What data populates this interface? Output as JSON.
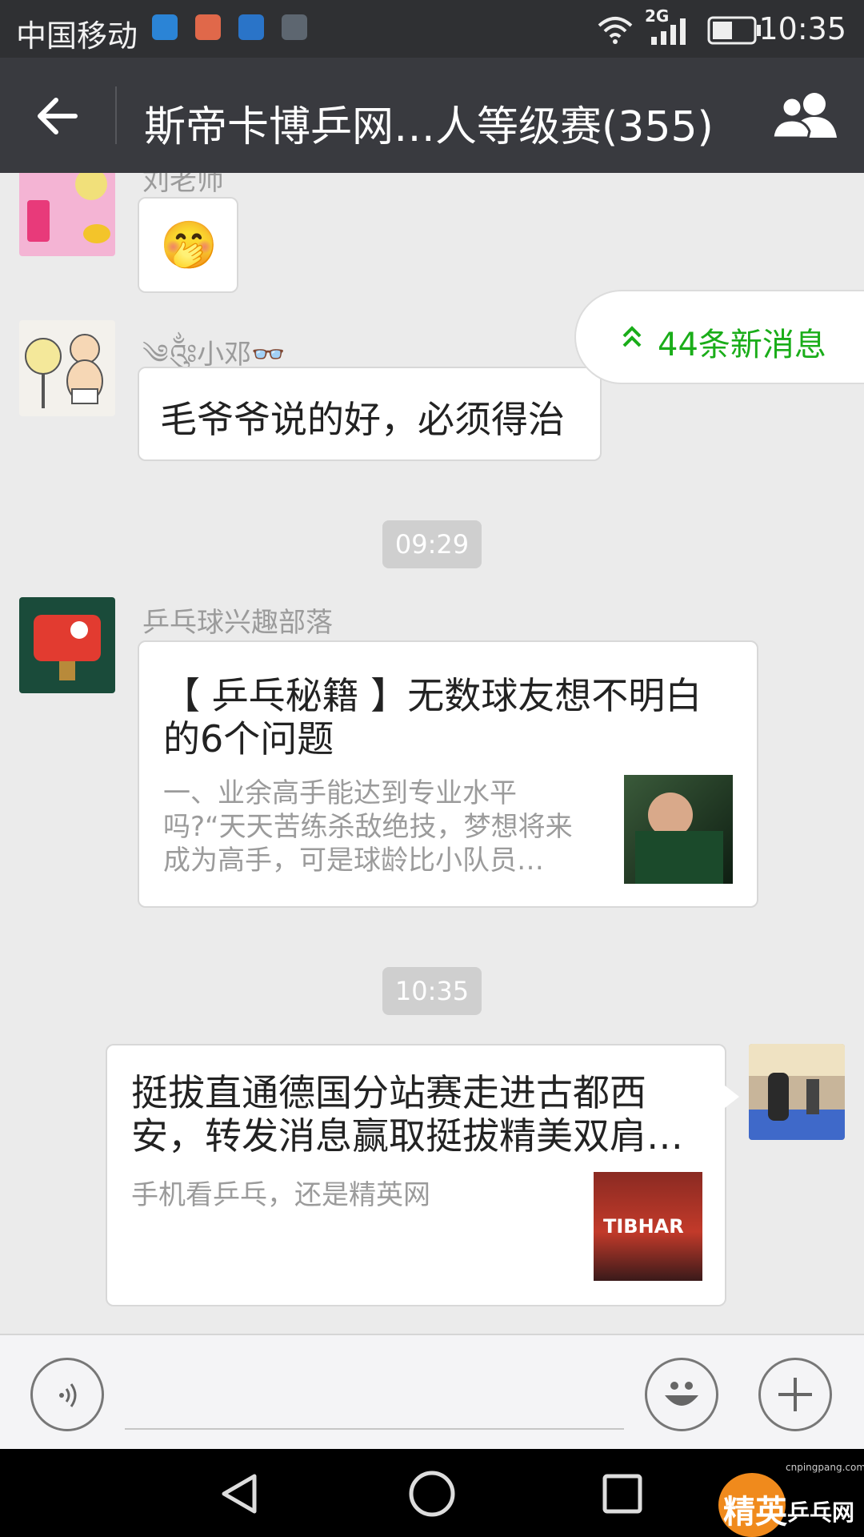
{
  "status_bar": {
    "carrier": "中国移动",
    "network": "2G",
    "time": "10:35",
    "icons": [
      "app-icon-blue",
      "mail-icon",
      "health-icon",
      "gallery-icon",
      "wifi-icon",
      "signal-icon",
      "battery-icon"
    ]
  },
  "header": {
    "title": "斯帝卡博乒网…人等级赛(355)",
    "back_icon": "arrow-left-icon",
    "members_icon": "group-icon"
  },
  "new_messages": {
    "label": "44条新消息",
    "icon": "double-chevron-up-icon"
  },
  "messages": [
    {
      "sender": "刘老师",
      "type": "emoji",
      "emoji": "🤭"
    },
    {
      "sender": "༄༂小邓👓",
      "type": "text",
      "text": "毛爷爷说的好，必须得治"
    },
    {
      "type": "timestamp",
      "time": "09:29"
    },
    {
      "sender": "乒乓球兴趣部落",
      "type": "link-card",
      "title": "【 乒乓秘籍 】无数球友想不明白的6个问题",
      "desc": "一、业余高手能达到专业水平吗?“天天苦练杀敌绝技，梦想将来成为高手，可是球龄比小队员…"
    },
    {
      "type": "timestamp",
      "time": "10:35"
    },
    {
      "sender": "",
      "type": "link-card-self",
      "title": "挺拔直通德国分站赛走进古都西安，转发消息赢取挺拔精美双肩…",
      "desc": "手机看乒乓，还是精英网",
      "thumb_text": "TIBHAR"
    }
  ],
  "input_bar": {
    "voice_icon": "voice-icon",
    "emoji_icon": "smiley-icon",
    "plus_icon": "plus-icon"
  },
  "watermark": {
    "text_main": "精英",
    "text_side": "乒乓网",
    "url": "cnpingpang.com"
  },
  "colors": {
    "accent_green": "#1aad19",
    "header_bg": "#393a3f",
    "status_bg": "#2f3033",
    "chat_bg": "#ebebeb"
  }
}
